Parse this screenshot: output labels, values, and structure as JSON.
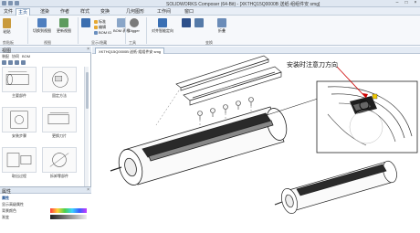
{
  "app": {
    "title": "SOLIDWORKS Composer (64-Bit) - [XKTHQ15Q0000B 送纸·组组件安 smg]",
    "minimize": "–",
    "maximize": "□",
    "close": "×"
  },
  "menu": {
    "tabs": [
      "文件",
      "主页",
      "渲染",
      "作者",
      "样式",
      "变换",
      "几何图形",
      "工作间",
      "窗口"
    ]
  },
  "ribbon": {
    "buttons": {
      "paste": "粘贴",
      "switch_viewpoint": "切换到视图",
      "update_viewpoint": "更新视图",
      "bom": "BOM 表格",
      "digger": "Digger",
      "smart_orient": "对齐智能定向",
      "explode": "爆炸",
      "collapse": "折叠"
    },
    "small": {
      "standard": "标准",
      "annotate": "编辑",
      "bom_id": "BOM ID"
    },
    "groups": [
      "剪贴板",
      "视图",
      "显示/隐藏",
      "工具",
      "变换"
    ]
  },
  "left_panel": {
    "title": "视图",
    "close": "×",
    "tabs": [
      "装配",
      "协同",
      "BOM"
    ],
    "thumbs": [
      "主要部件",
      "固定方法",
      "安装步骤",
      "更换刀片",
      "取出过程",
      "拆卸零部件"
    ]
  },
  "properties": {
    "title": "属性",
    "close": "×",
    "rows": [
      {
        "label": "属性",
        "category": true
      },
      {
        "label": "显示高级属性",
        "category": false
      },
      {
        "label": "背景颜色",
        "category": false
      },
      {
        "label": "渐变",
        "category": false
      }
    ]
  },
  "document": {
    "tab_label": "XKTHQ15Q0000B 送纸·组组件安 smg",
    "callout": "安装时注意刀方向"
  },
  "colors": {
    "accent": "#1f4e8c",
    "ribbon_bg": "#f6f8fb",
    "panel_header": "#dfe7f1"
  }
}
